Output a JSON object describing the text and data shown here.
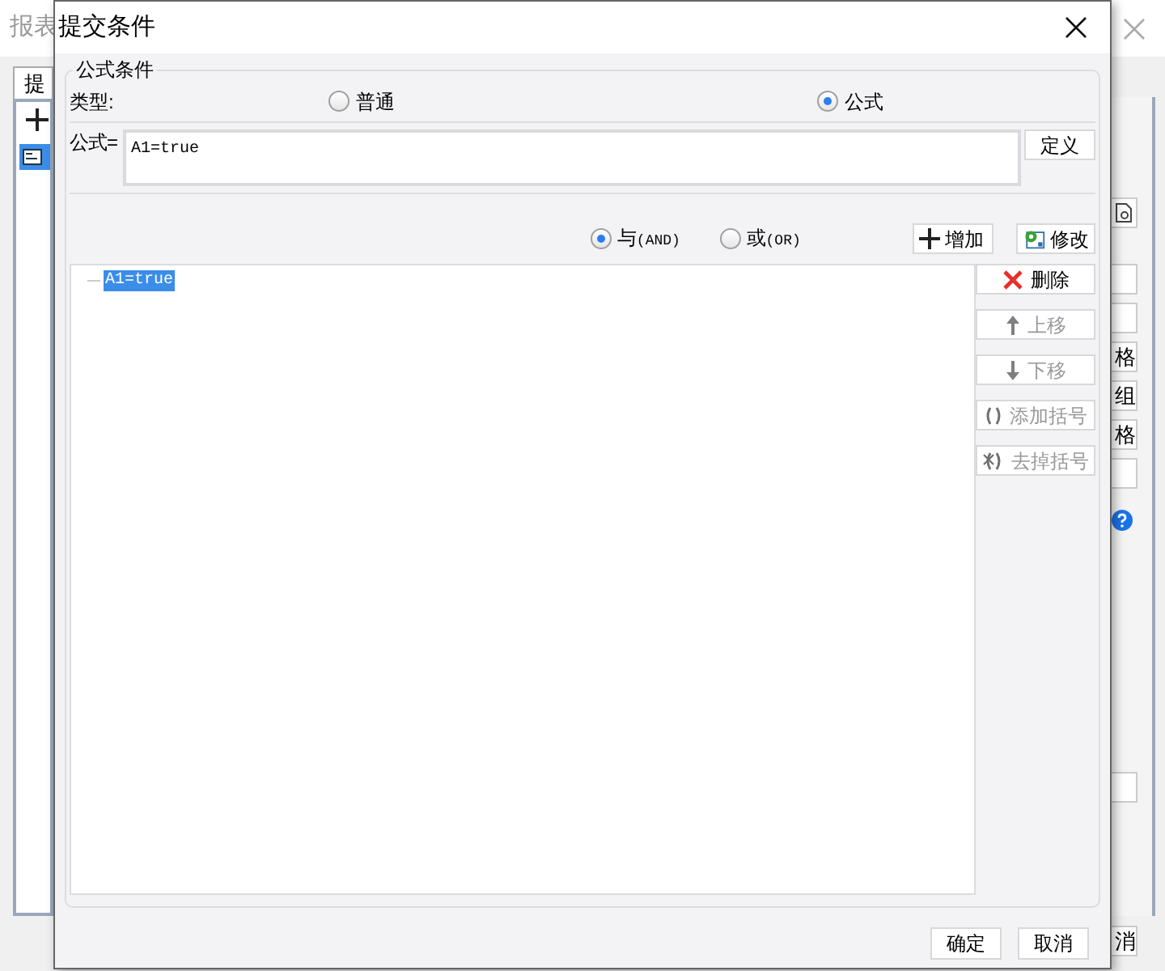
{
  "background_window": {
    "title": "报表",
    "tab": "提",
    "side_buttons": [
      {
        "kind": "icon"
      },
      {
        "kind": "text"
      },
      {
        "kind": "text"
      },
      {
        "kind": "text",
        "label": "格"
      },
      {
        "kind": "text",
        "label": "组"
      },
      {
        "kind": "text",
        "label": "格"
      },
      {
        "kind": "text"
      },
      {
        "kind": "help"
      }
    ],
    "bottom_button": "消"
  },
  "dialog": {
    "title": "提交条件",
    "group_title": "公式条件",
    "type_label": "类型:",
    "type_options": [
      {
        "label": "普通",
        "selected": false
      },
      {
        "label": "公式",
        "selected": true
      }
    ],
    "formula_label": "公式=",
    "formula_value": "A1=true",
    "define_button": "定义",
    "logic_options": [
      {
        "label": "与",
        "code": "(AND)",
        "selected": true
      },
      {
        "label": "或",
        "code": "(OR)",
        "selected": false
      }
    ],
    "toolbar_buttons": [
      {
        "kind": "add",
        "label": "增加"
      },
      {
        "kind": "edit",
        "label": "修改"
      }
    ],
    "conditions": [
      {
        "text": "A1=true",
        "selected": true
      }
    ],
    "side_buttons": [
      {
        "kind": "delete",
        "label": "删除",
        "disabled": false
      },
      {
        "kind": "up",
        "label": "上移",
        "disabled": true
      },
      {
        "kind": "down",
        "label": "下移",
        "disabled": true
      },
      {
        "kind": "add_bracket",
        "label": "添加括号",
        "disabled": true
      },
      {
        "kind": "remove_bracket",
        "label": "去掉括号",
        "disabled": true
      }
    ],
    "footer_buttons": [
      "确定",
      "取消"
    ]
  }
}
